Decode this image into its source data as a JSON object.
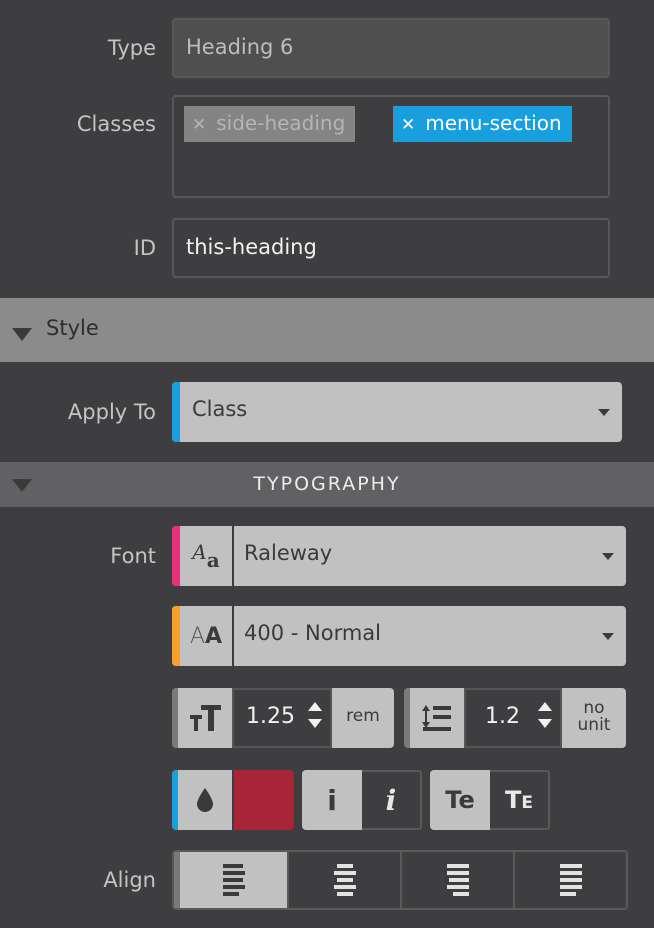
{
  "fields": {
    "type": {
      "label": "Type",
      "value": "Heading 6"
    },
    "classes": {
      "label": "Classes",
      "tags": [
        {
          "name": "side-heading",
          "remove_icon": "close-icon",
          "active": false,
          "color": "#848484"
        },
        {
          "name": "menu-section",
          "remove_icon": "close-icon",
          "active": true,
          "color": "#1a9fde"
        }
      ]
    },
    "id": {
      "label": "ID",
      "value": "this-heading"
    }
  },
  "style_section": {
    "title": "Style",
    "apply_to": {
      "label": "Apply To",
      "value": "Class",
      "accent": "#1a9fde"
    }
  },
  "typography": {
    "title": "TYPOGRAPHY",
    "font": {
      "label": "Font",
      "value": "Raleway",
      "icon": "font-family-icon",
      "icon_text": "Aa",
      "accent": "#e8317a"
    },
    "weight": {
      "value": "400 - Normal",
      "icon": "font-weight-icon",
      "icon_text": "AA",
      "accent": "#f5a02a"
    },
    "font_size": {
      "icon": "font-size-icon",
      "icon_text": "TT",
      "value": "1.25",
      "unit": "rem"
    },
    "line_height": {
      "icon": "line-height-icon",
      "value": "1.2",
      "unit_line1": "no",
      "unit_line2": "unit"
    },
    "color": {
      "icon": "color-drop-icon",
      "swatch": "#a82537",
      "accent": "#1a9fde"
    },
    "style_buttons": [
      {
        "name": "normal-style",
        "glyph": "i",
        "active": true
      },
      {
        "name": "italic-style",
        "glyph": "i",
        "active": false
      }
    ],
    "transform_buttons": [
      {
        "name": "normal-case",
        "glyph": "Te",
        "active": true
      },
      {
        "name": "small-caps",
        "glyph": "TE",
        "active": false
      }
    ],
    "align": {
      "label": "Align",
      "options": [
        "left",
        "center",
        "right",
        "justify"
      ],
      "selected": "left"
    }
  }
}
